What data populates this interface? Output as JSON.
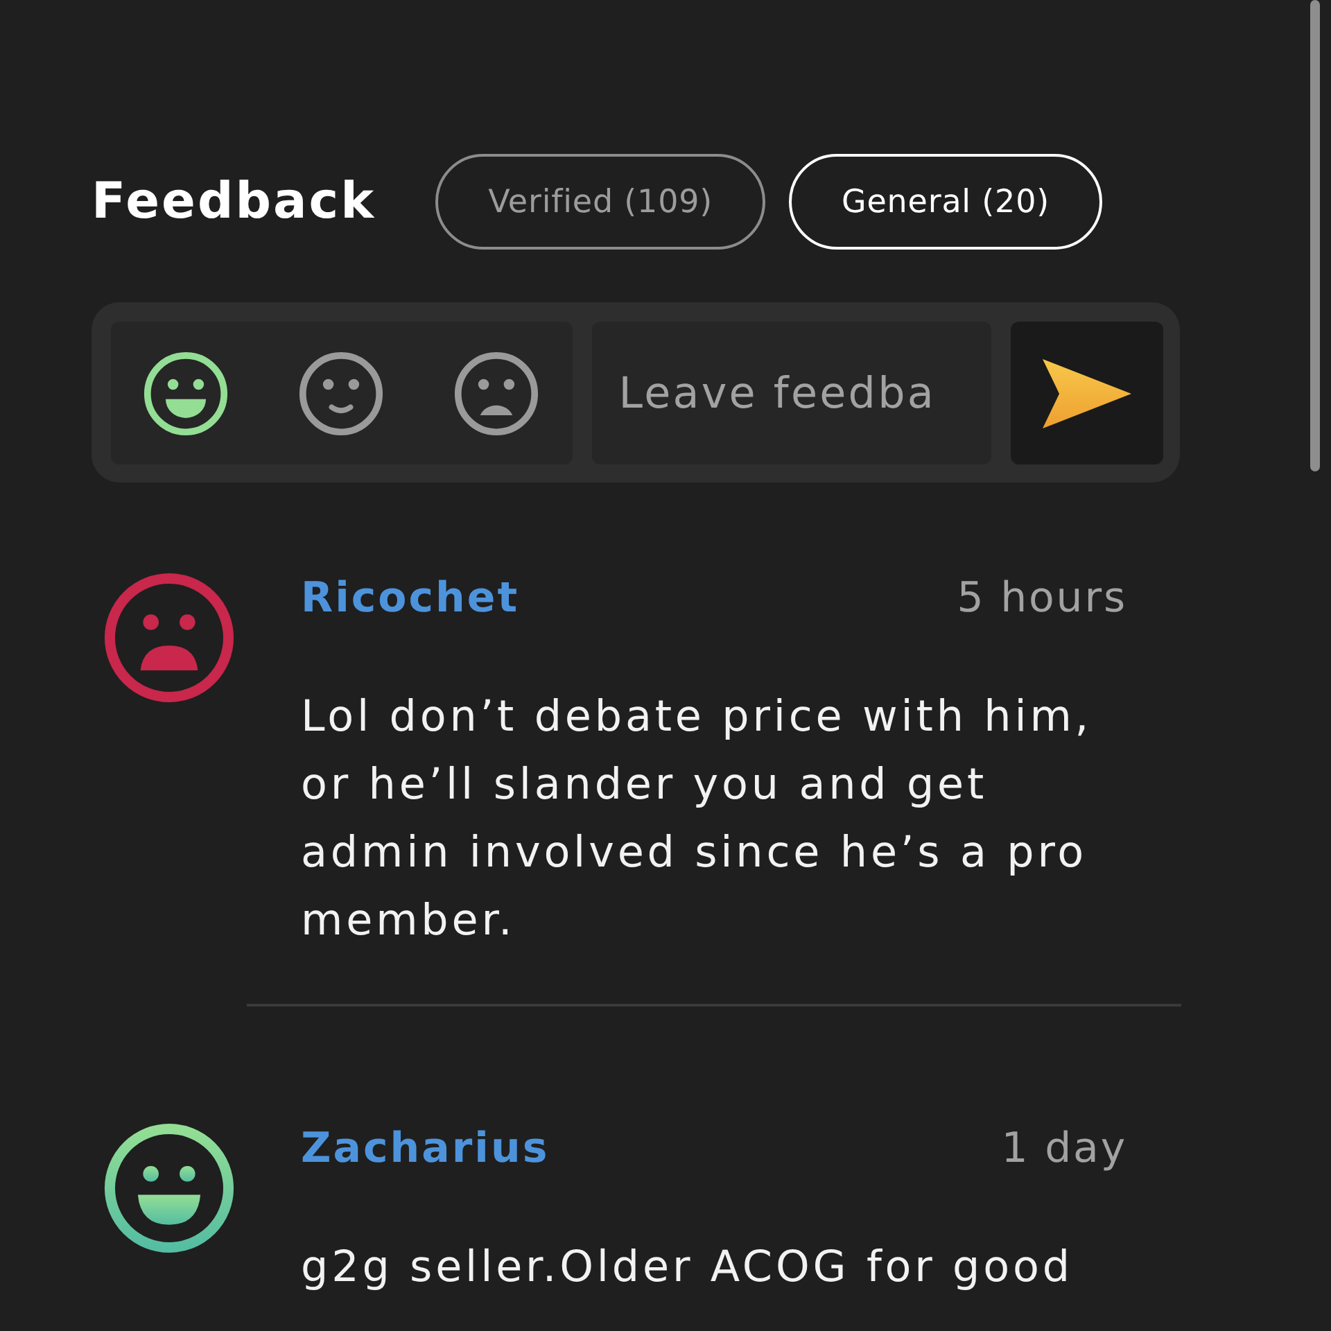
{
  "header": {
    "title": "Feedback"
  },
  "tabs": [
    {
      "label": "Verified (109)",
      "selected": false
    },
    {
      "label": "General (20)",
      "selected": true
    }
  ],
  "composer": {
    "rating_options": [
      {
        "kind": "positive",
        "selected": true
      },
      {
        "kind": "neutral",
        "selected": false
      },
      {
        "kind": "negative",
        "selected": false
      }
    ],
    "placeholder": "Leave feedba"
  },
  "comments": [
    {
      "kind": "negative",
      "author": "Ricochet",
      "time": "5 hours",
      "text": "Lol don’t debate price with him, or he’ll slander you and get admin involved since he’s a pro member."
    },
    {
      "kind": "positive",
      "author": "Zacharius",
      "time": "1 day",
      "text": "g2g seller.Older ACOG for good"
    }
  ]
}
